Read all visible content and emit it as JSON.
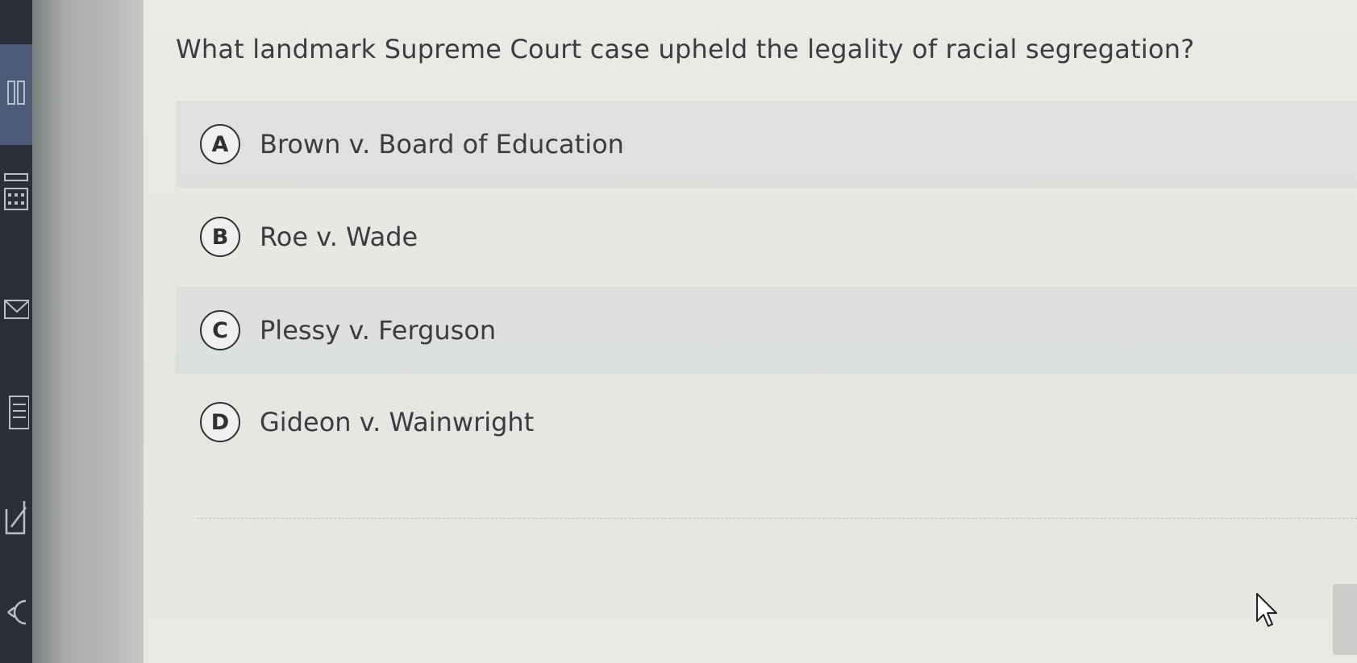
{
  "question": {
    "text": "What landmark Supreme Court case upheld the legality of racial segregation?"
  },
  "options": [
    {
      "letter": "A",
      "text": "Brown v. Board of Education"
    },
    {
      "letter": "B",
      "text": "Roe v. Wade"
    },
    {
      "letter": "C",
      "text": "Plessy v. Ferguson"
    },
    {
      "letter": "D",
      "text": "Gideon v. Wainwright"
    }
  ],
  "icons": {
    "sidebar": [
      "grid-icon",
      "calculator-icon",
      "mail-icon",
      "notes-icon",
      "edit-icon",
      "undo-icon"
    ],
    "cursor": "pointer-cursor-icon"
  },
  "colors": {
    "sidebar": "#2a2f3a",
    "sidebar_active": "#4a5a78",
    "content_bg": "#e9ebe7",
    "text": "#3a3c3e"
  }
}
